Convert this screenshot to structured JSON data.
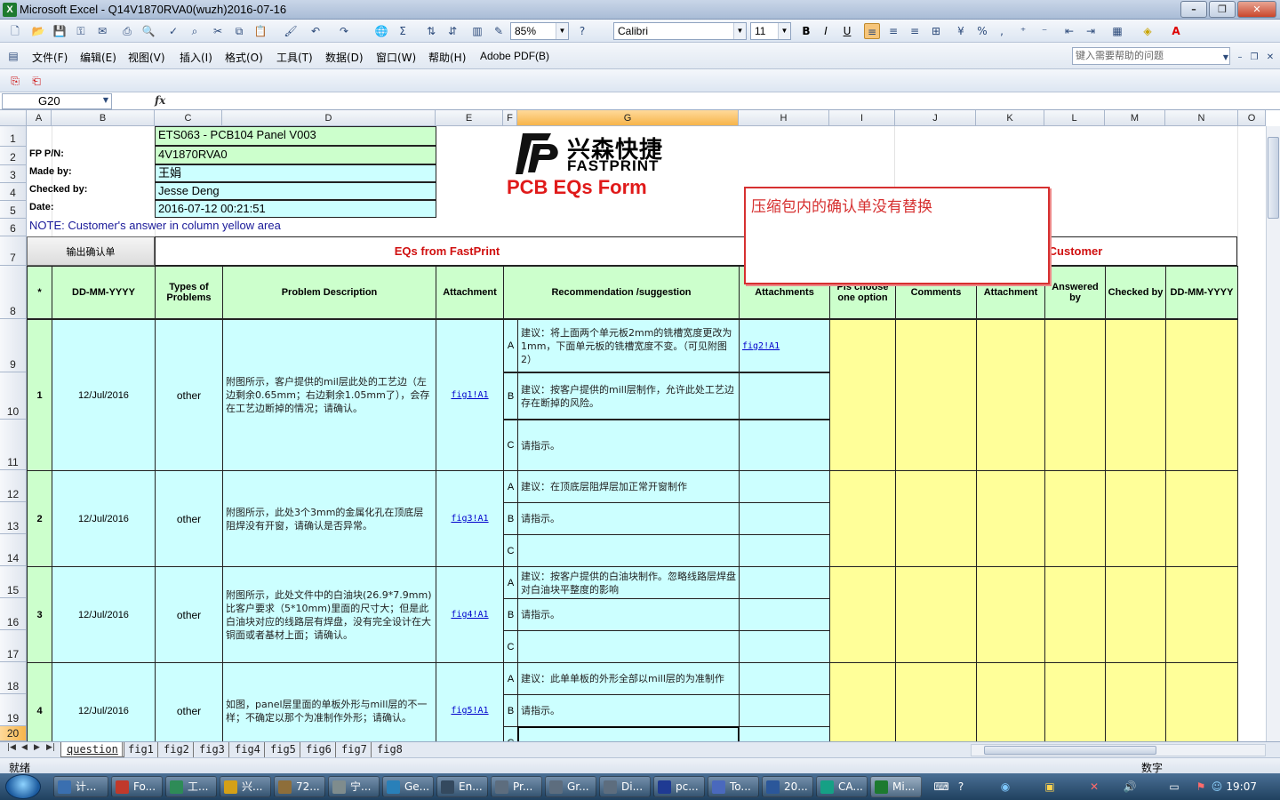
{
  "window": {
    "title": "Microsoft Excel - Q14V1870RVA0(wuzh)2016-07-16",
    "app_icon": "X"
  },
  "toolbar": {
    "zoom": "85%",
    "font": "Calibri",
    "size": "11"
  },
  "menu": [
    "文件(F)",
    "编辑(E)",
    "视图(V)",
    "插入(I)",
    "格式(O)",
    "工具(T)",
    "数据(D)",
    "窗口(W)",
    "帮助(H)",
    "Adobe PDF(B)"
  ],
  "help_placeholder": "键入需要帮助的问题",
  "formula": {
    "namebox": "G20",
    "fx": "fx"
  },
  "columns": [
    "A",
    "B",
    "C",
    "D",
    "E",
    "F",
    "G",
    "H",
    "I",
    "J",
    "K",
    "L",
    "M",
    "N",
    "O"
  ],
  "rows": [
    "1",
    "2",
    "3",
    "4",
    "5",
    "6",
    "7",
    "8",
    "9",
    "10",
    "11",
    "12",
    "13",
    "14",
    "15",
    "16",
    "17",
    "18",
    "19",
    "20"
  ],
  "info": {
    "labels": [
      "FP P/N:",
      "Made by:",
      "Checked by:",
      "Date:"
    ],
    "values": [
      "ETS063 - PCB104 Panel V003",
      "4V1870RVA0",
      "王娟",
      "Jesse Deng",
      "2016-07-12 00:21:51"
    ]
  },
  "logo": {
    "cn": "兴森快捷",
    "en": "FASTPRINT"
  },
  "form_title": "PCB EQs Form",
  "note": "NOTE: Customer's  answer in column yellow area",
  "export_button": "输出确认单",
  "section_left": "EQs from FastPrint",
  "section_right": "Customer",
  "headers": {
    "star": "*",
    "date": "DD-MM-YYYY",
    "types": "Types of Problems",
    "problem": "Problem Description",
    "attachment": "Attachment",
    "recommendation": "Recommendation /suggestion",
    "attachments": "Attachments",
    "choose": "Pls choose one option",
    "comments": "Comments",
    "c_attachment": "Attachment",
    "answered": "Answered by",
    "checked": "Checked by",
    "c_date": "DD-MM-YYYY"
  },
  "eqs": [
    {
      "no": "1",
      "date": "12/Jul/2016",
      "type": "other",
      "desc": "附图所示，客户提供的mil层此处的工艺边（左边剩余0.65mm；右边剩余1.05mm了），会存在工艺边断掉的情况；请确认。",
      "attach": "fig1!A1",
      "options": [
        {
          "letter": "A",
          "text": "建议：将上面两个单元板2mm的铣槽宽度更改为1mm，下面单元板的铣槽宽度不变。（可见附图2）",
          "attach": "fig2!A1"
        },
        {
          "letter": "B",
          "text": "建议：按客户提供的mill层制作，允许此处工艺边存在断掉的风险。",
          "attach": ""
        },
        {
          "letter": "C",
          "text": "请指示。",
          "attach": ""
        }
      ]
    },
    {
      "no": "2",
      "date": "12/Jul/2016",
      "type": "other",
      "desc": "附图所示，此处3个3mm的金属化孔在顶底层阻焊没有开窗，请确认是否异常。",
      "attach": "fig3!A1",
      "options": [
        {
          "letter": "A",
          "text": "建议：在顶底层阻焊层加正常开窗制作",
          "attach": ""
        },
        {
          "letter": "B",
          "text": "请指示。",
          "attach": ""
        },
        {
          "letter": "C",
          "text": "",
          "attach": ""
        }
      ]
    },
    {
      "no": "3",
      "date": "12/Jul/2016",
      "type": "other",
      "desc": "附图所示，此处文件中的白油块(26.9*7.9mm)比客户要求（5*10mm)里面的尺寸大；但是此白油块对应的线路层有焊盘，没有完全设计在大铜面或者基材上面；请确认。",
      "attach": "fig4!A1",
      "options": [
        {
          "letter": "A",
          "text": "建议：按客户提供的白油块制作。忽略线路层焊盘对白油块平整度的影响",
          "attach": ""
        },
        {
          "letter": "B",
          "text": "请指示。",
          "attach": ""
        },
        {
          "letter": "C",
          "text": "",
          "attach": ""
        }
      ]
    },
    {
      "no": "4",
      "date": "12/Jul/2016",
      "type": "other",
      "desc": "如图，panel层里面的单板外形与mill层的不一样；不确定以那个为准制作外形；请确认。",
      "attach": "fig5!A1",
      "options": [
        {
          "letter": "A",
          "text": "建议：此单单板的外形全部以mill层的为准制作",
          "attach": ""
        },
        {
          "letter": "B",
          "text": "请指示。",
          "attach": ""
        },
        {
          "letter": "C",
          "text": "",
          "attach": ""
        }
      ]
    }
  ],
  "comment": "压缩包内的确认单没有替换",
  "tabs": [
    "question",
    "fig1",
    "fig2",
    "fig3",
    "fig4",
    "fig5",
    "fig6",
    "fig7",
    "fig8"
  ],
  "status": {
    "left": "就绪",
    "mode": "数字"
  },
  "taskbar": [
    {
      "label": "计...",
      "color": "#3a6fb0"
    },
    {
      "label": "Fo...",
      "color": "#c0392b"
    },
    {
      "label": "工...",
      "color": "#2e8b57"
    },
    {
      "label": "兴...",
      "color": "#d4a017"
    },
    {
      "label": "72...",
      "color": "#8e6e3a"
    },
    {
      "label": "宁...",
      "color": "#7f8c8d"
    },
    {
      "label": "Ge...",
      "color": "#2980b9"
    },
    {
      "label": "En...",
      "color": "#34495e"
    },
    {
      "label": "Pr...",
      "color": "#5d6d7e"
    },
    {
      "label": "Gr...",
      "color": "#5d6d7e"
    },
    {
      "label": "Di...",
      "color": "#5d6d7e"
    },
    {
      "label": "pc...",
      "color": "#1f3a93"
    },
    {
      "label": "To...",
      "color": "#4a69bd"
    },
    {
      "label": "20...",
      "color": "#2b579a"
    },
    {
      "label": "CA...",
      "color": "#16a085"
    },
    {
      "label": "Mi...",
      "color": "#1d7a2f"
    }
  ],
  "clock": "19:07"
}
